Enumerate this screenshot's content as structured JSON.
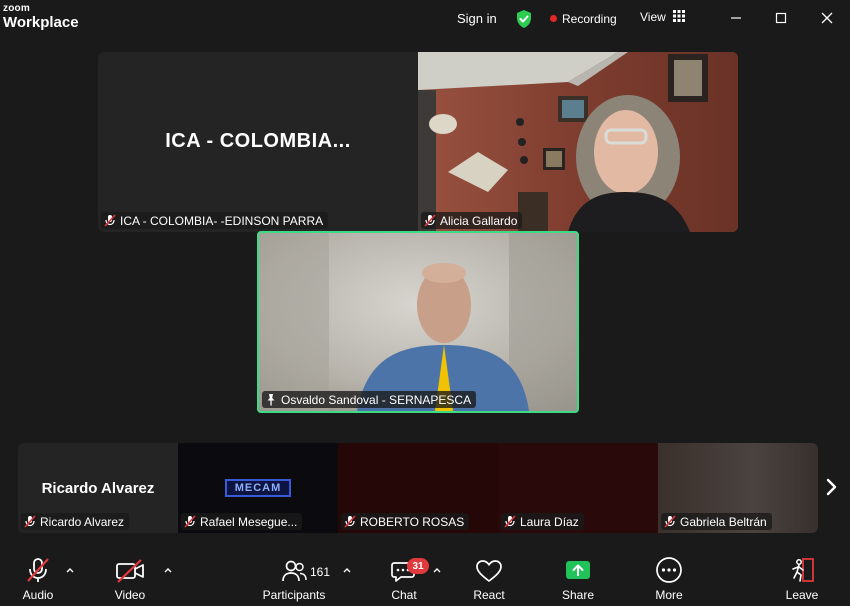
{
  "app": {
    "brand_small": "zoom",
    "brand_large": "Workplace"
  },
  "titlebar": {
    "sign_in": "Sign in",
    "recording": "Recording",
    "view": "View"
  },
  "tiles": {
    "ica_display": "ICA - COLOMBIA...",
    "ica_name": "ICA - COLOMBIA- -EDINSON PARRA",
    "alicia_name": "Alicia Gallardo",
    "osvaldo_name": "Osvaldo Sandoval - SERNAPESCA"
  },
  "strip": {
    "items": [
      {
        "display": "Ricardo Alvarez",
        "name": "Ricardo Alvarez"
      },
      {
        "display": "MECAM",
        "name": "Rafael Mesegue..."
      },
      {
        "display": "",
        "name": "ROBERTO ROSAS"
      },
      {
        "display": "",
        "name": "Laura Díaz"
      },
      {
        "display": "",
        "name": "Gabriela Beltrán"
      }
    ]
  },
  "toolbar": {
    "audio": "Audio",
    "video": "Video",
    "participants": "Participants",
    "participants_count": "161",
    "chat": "Chat",
    "chat_badge": "31",
    "react": "React",
    "share": "Share",
    "more": "More",
    "leave": "Leave"
  },
  "colors": {
    "active_speaker": "#3ddc84",
    "share": "#22c25a",
    "badge": "#e0393e",
    "shield": "#2ecc52"
  }
}
